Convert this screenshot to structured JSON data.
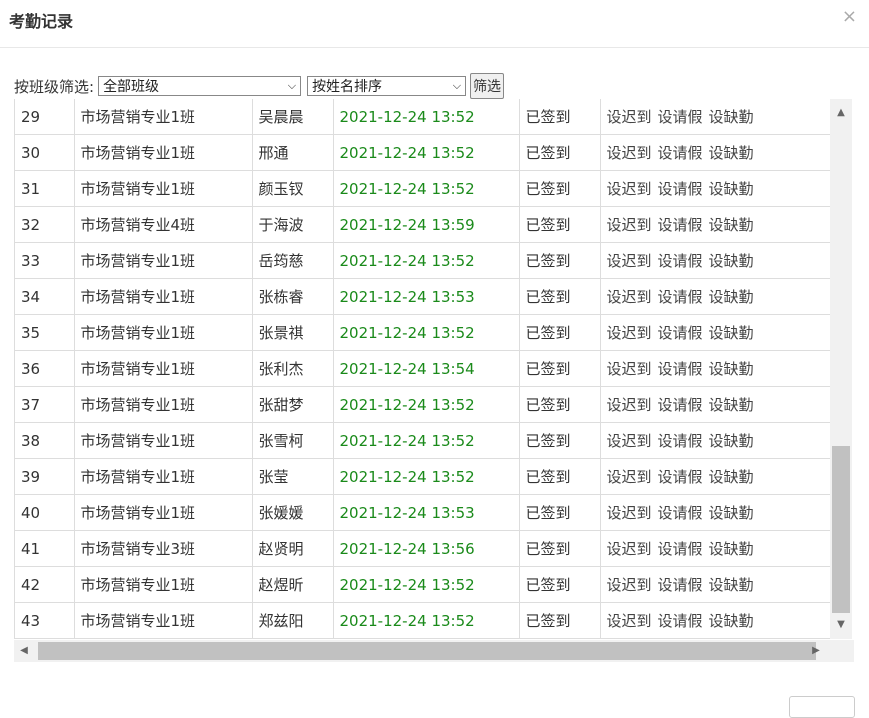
{
  "dialog": {
    "title": "考勤记录",
    "close_glyph": "×"
  },
  "filter": {
    "label": "按班级筛选:",
    "class_select": "全部班级",
    "sort_select": "按姓名排序",
    "filter_button": "筛选"
  },
  "colors": {
    "time_text": "#1a8a1a",
    "scroll_thumb": "#c1c1c1"
  },
  "rows": [
    {
      "no": "29",
      "class": "市场营销专业1班",
      "name": "吴晨晨",
      "time": "2021-12-24 13:52",
      "status": "已签到",
      "a1": "设迟到",
      "a2": "设请假",
      "a3": "设缺勤"
    },
    {
      "no": "30",
      "class": "市场营销专业1班",
      "name": "邢通",
      "time": "2021-12-24 13:52",
      "status": "已签到",
      "a1": "设迟到",
      "a2": "设请假",
      "a3": "设缺勤"
    },
    {
      "no": "31",
      "class": "市场营销专业1班",
      "name": "颜玉钗",
      "time": "2021-12-24 13:52",
      "status": "已签到",
      "a1": "设迟到",
      "a2": "设请假",
      "a3": "设缺勤"
    },
    {
      "no": "32",
      "class": "市场营销专业4班",
      "name": "于海波",
      "time": "2021-12-24 13:59",
      "status": "已签到",
      "a1": "设迟到",
      "a2": "设请假",
      "a3": "设缺勤"
    },
    {
      "no": "33",
      "class": "市场营销专业1班",
      "name": "岳筠慈",
      "time": "2021-12-24 13:52",
      "status": "已签到",
      "a1": "设迟到",
      "a2": "设请假",
      "a3": "设缺勤"
    },
    {
      "no": "34",
      "class": "市场营销专业1班",
      "name": "张栋睿",
      "time": "2021-12-24 13:53",
      "status": "已签到",
      "a1": "设迟到",
      "a2": "设请假",
      "a3": "设缺勤"
    },
    {
      "no": "35",
      "class": "市场营销专业1班",
      "name": "张景祺",
      "time": "2021-12-24 13:52",
      "status": "已签到",
      "a1": "设迟到",
      "a2": "设请假",
      "a3": "设缺勤"
    },
    {
      "no": "36",
      "class": "市场营销专业1班",
      "name": "张利杰",
      "time": "2021-12-24 13:54",
      "status": "已签到",
      "a1": "设迟到",
      "a2": "设请假",
      "a3": "设缺勤"
    },
    {
      "no": "37",
      "class": "市场营销专业1班",
      "name": "张甜梦",
      "time": "2021-12-24 13:52",
      "status": "已签到",
      "a1": "设迟到",
      "a2": "设请假",
      "a3": "设缺勤"
    },
    {
      "no": "38",
      "class": "市场营销专业1班",
      "name": "张雪柯",
      "time": "2021-12-24 13:52",
      "status": "已签到",
      "a1": "设迟到",
      "a2": "设请假",
      "a3": "设缺勤"
    },
    {
      "no": "39",
      "class": "市场营销专业1班",
      "name": "张莹",
      "time": "2021-12-24 13:52",
      "status": "已签到",
      "a1": "设迟到",
      "a2": "设请假",
      "a3": "设缺勤"
    },
    {
      "no": "40",
      "class": "市场营销专业1班",
      "name": "张媛媛",
      "time": "2021-12-24 13:53",
      "status": "已签到",
      "a1": "设迟到",
      "a2": "设请假",
      "a3": "设缺勤"
    },
    {
      "no": "41",
      "class": "市场营销专业3班",
      "name": "赵贤明",
      "time": "2021-12-24 13:56",
      "status": "已签到",
      "a1": "设迟到",
      "a2": "设请假",
      "a3": "设缺勤"
    },
    {
      "no": "42",
      "class": "市场营销专业1班",
      "name": "赵煜昕",
      "time": "2021-12-24 13:52",
      "status": "已签到",
      "a1": "设迟到",
      "a2": "设请假",
      "a3": "设缺勤"
    },
    {
      "no": "43",
      "class": "市场营销专业1班",
      "name": "郑兹阳",
      "time": "2021-12-24 13:52",
      "status": "已签到",
      "a1": "设迟到",
      "a2": "设请假",
      "a3": "设缺勤"
    }
  ]
}
